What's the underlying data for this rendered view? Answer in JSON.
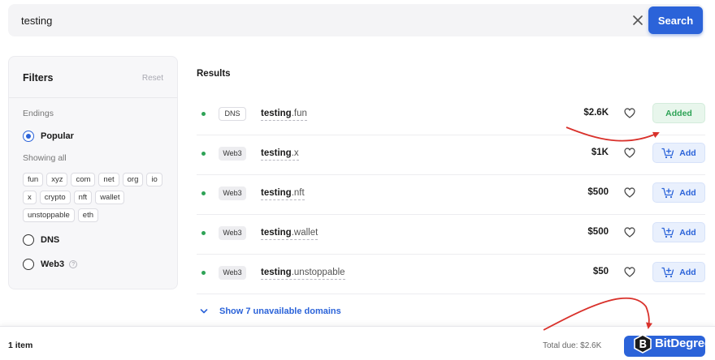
{
  "search": {
    "value": "testing",
    "button_label": "Search"
  },
  "filters": {
    "title": "Filters",
    "reset_label": "Reset",
    "endings_label": "Endings",
    "popular_label": "Popular",
    "showing_label": "Showing all",
    "endings": [
      "fun",
      "xyz",
      "com",
      "net",
      "org",
      "io",
      "x",
      "crypto",
      "nft",
      "wallet",
      "unstoppable",
      "eth"
    ],
    "dns_label": "DNS",
    "web3_label": "Web3",
    "selected": "Popular"
  },
  "results": {
    "title": "Results",
    "rows": [
      {
        "type": "DNS",
        "base": "testing",
        "ext": ".fun",
        "price": "$2.6K",
        "action": "Added",
        "status_color": "#2ea356"
      },
      {
        "type": "Web3",
        "base": "testing",
        "ext": ".x",
        "price": "$1K",
        "action": "Add",
        "status_color": "#2ea356"
      },
      {
        "type": "Web3",
        "base": "testing",
        "ext": ".nft",
        "price": "$500",
        "action": "Add",
        "status_color": "#2ea356"
      },
      {
        "type": "Web3",
        "base": "testing",
        "ext": ".wallet",
        "price": "$500",
        "action": "Add",
        "status_color": "#2ea356"
      },
      {
        "type": "Web3",
        "base": "testing",
        "ext": ".unstoppable",
        "price": "$50",
        "action": "Add",
        "status_color": "#2ea356"
      }
    ],
    "show_unavailable": "Show 7 unavailable domains"
  },
  "cart": {
    "item_count": "1 item",
    "total_due": "Total due: $2.6K"
  },
  "watermark": {
    "text": "BitDegree"
  },
  "colors": {
    "accent": "#2b63d9",
    "success": "#2ea356",
    "annotation": "#d9312b"
  },
  "icons": [
    "clear-icon",
    "heart-icon",
    "cart-add-icon",
    "chevron-down-icon",
    "help-icon"
  ]
}
